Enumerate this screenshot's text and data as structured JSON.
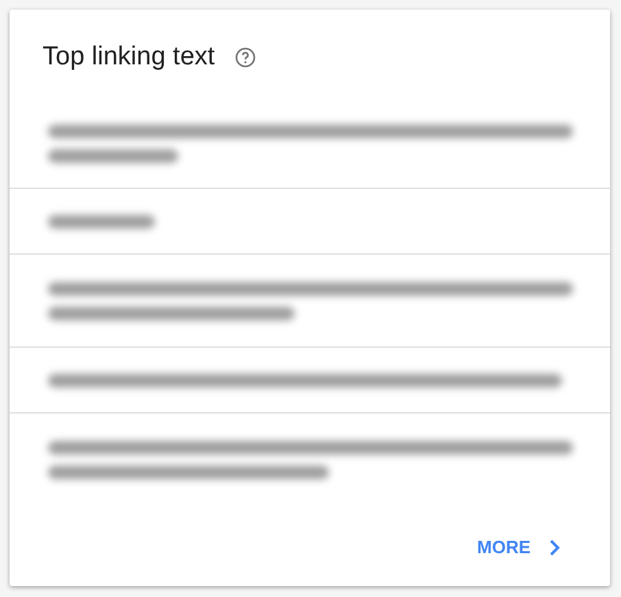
{
  "card": {
    "title": "Top linking text",
    "help": true
  },
  "rows": [
    {
      "kind": "two_lines"
    },
    {
      "kind": "short_line"
    },
    {
      "kind": "two_lines_medium"
    },
    {
      "kind": "long_line"
    },
    {
      "kind": "two_lines_wide"
    }
  ],
  "footer": {
    "more_label": "MORE"
  }
}
